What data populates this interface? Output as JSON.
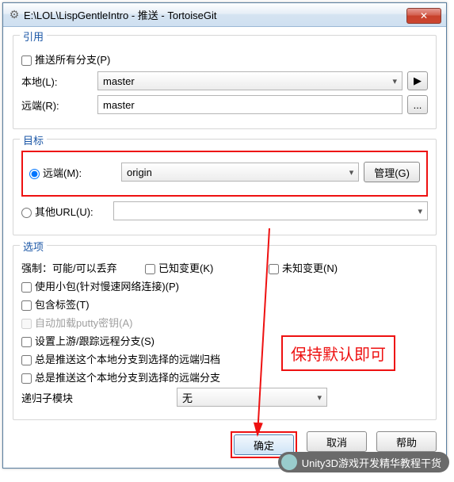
{
  "title": "E:\\LOL\\LispGentleIntro - 推送 - TortoiseGit",
  "ref": {
    "group": "引用",
    "push_all": "推送所有分支(P)",
    "local_l": "本地(L):",
    "local_v": "master",
    "remote_l": "远端(R):",
    "remote_v": "master",
    "play": "▶",
    "dots": "..."
  },
  "target": {
    "group": "目标",
    "remote_l": "远端(M):",
    "remote_v": "origin",
    "manage": "管理(G)",
    "other_l": "其他URL(U):",
    "other_v": ""
  },
  "opts": {
    "group": "选项",
    "force_l": "强制：可能/可以丢弃",
    "known": "已知变更(K)",
    "unknown": "未知变更(N)",
    "thinpack": "使用小包(针对慢速网络连接)(P)",
    "tags": "包含标签(T)",
    "putty": "自动加载putty密钥(A)",
    "upstream": "设置上游/跟踪远程分支(S)",
    "archive": "总是推送这个本地分支到选择的远端归档",
    "branch": "总是推送这个本地分支到选择的远端分支",
    "sub_l": "递归子模块",
    "sub_v": "无"
  },
  "buttons": {
    "ok": "确定",
    "cancel": "取消",
    "help": "帮助"
  },
  "annot": "保持默认即可",
  "footer": "Unity3D游戏开发精华教程干货"
}
